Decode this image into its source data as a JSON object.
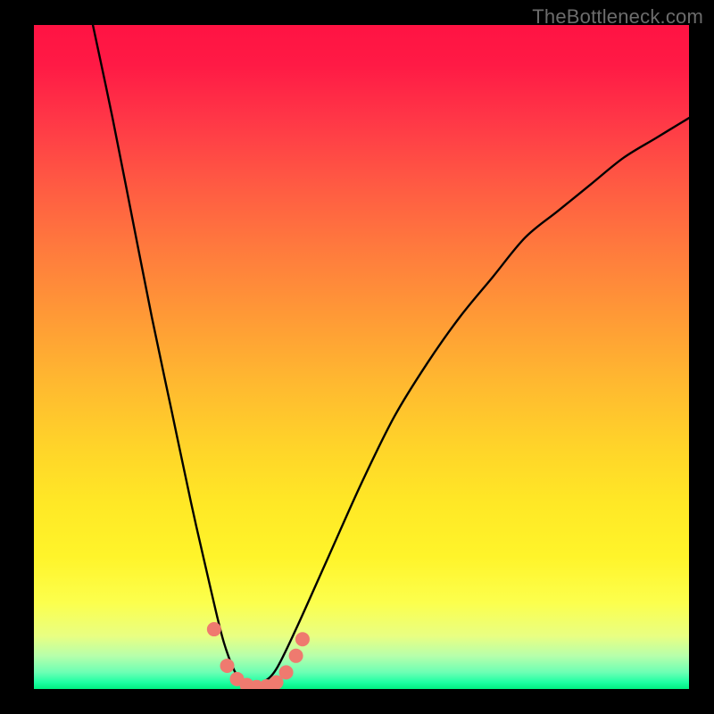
{
  "watermark": "TheBottleneck.com",
  "chart_data": {
    "type": "line",
    "title": "",
    "xlabel": "",
    "ylabel": "",
    "xlim": [
      0,
      100
    ],
    "ylim": [
      0,
      100
    ],
    "background_gradient": {
      "top": "#ff1343",
      "bottom": "#00ee81"
    },
    "curve": {
      "description": "V-shaped bottleneck curve; y is approximate penalty (higher = worse), trough near x≈33 at y≈0.",
      "x": [
        9,
        12,
        15,
        18,
        21,
        24,
        27,
        29,
        31,
        33,
        35,
        37,
        40,
        45,
        50,
        55,
        60,
        65,
        70,
        75,
        80,
        85,
        90,
        95,
        100
      ],
      "y": [
        100,
        86,
        71,
        56,
        42,
        28,
        15,
        7,
        2,
        0,
        1,
        3,
        9,
        20,
        31,
        41,
        49,
        56,
        62,
        68,
        72,
        76,
        80,
        83,
        86
      ]
    },
    "markers": {
      "description": "Coral dots along the trough of the curve.",
      "x": [
        27.5,
        29.5,
        31.0,
        32.5,
        34.0,
        35.5,
        37.0,
        38.5,
        40.0,
        41.0
      ],
      "y": [
        9.0,
        3.5,
        1.5,
        0.6,
        0.3,
        0.4,
        1.0,
        2.5,
        5.0,
        7.5
      ],
      "color": "#ef7a6f",
      "radius_px": 8
    }
  }
}
